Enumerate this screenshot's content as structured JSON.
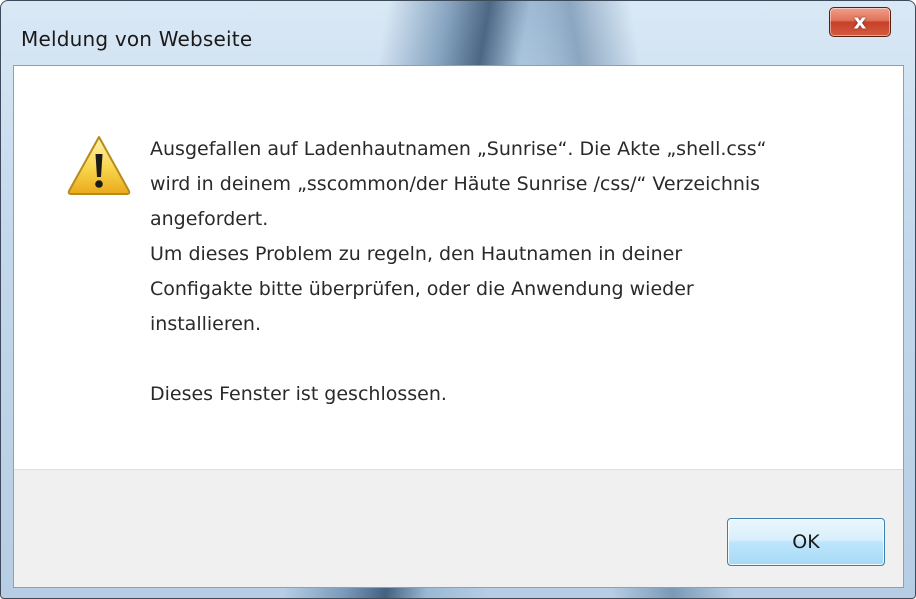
{
  "window": {
    "title": "Meldung von Webseite",
    "close_glyph": "x"
  },
  "icon": {
    "name": "warning-icon",
    "colors": {
      "fill_top": "#fde98a",
      "fill_bottom": "#f3c02a",
      "border": "#b78a1a",
      "mark": "#1a1a1a"
    }
  },
  "message": {
    "lines": [
      "Ausgefallen auf Ladenhautnamen „Sunrise“. Die Akte „shell.css“",
      "wird in deinem „sscommon/der Häute Sunrise /css/“ Verzeichnis",
      "angefordert.",
      "Um dieses Problem zu regeln, den Hautnamen in deiner",
      "Configakte bitte überprüfen, oder die Anwendung wieder",
      "installieren."
    ],
    "closing": "Dieses Fenster ist geschlossen."
  },
  "buttons": {
    "ok_label": "OK"
  },
  "colors": {
    "close_button": "#d9553a",
    "ok_button_border": "#3c7fb1",
    "button_bar": "#f0f0f0"
  }
}
